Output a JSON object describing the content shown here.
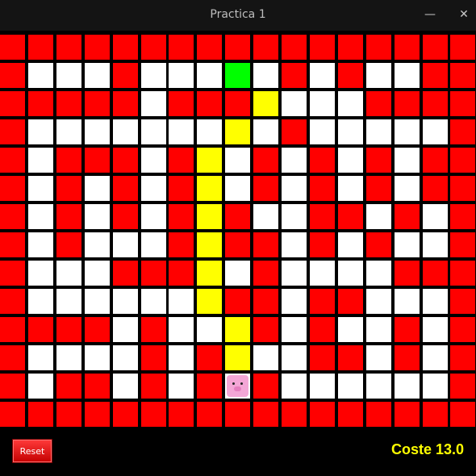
{
  "window": {
    "title": "Practica 1",
    "minimize_glyph": "—",
    "close_glyph": "✕"
  },
  "legend": {
    "W": "wall",
    ".": "free",
    "P": "path",
    "G": "goal",
    "S": "start"
  },
  "colors": {
    "wall": "#ff0000",
    "free": "#ffffff",
    "path": "#ffff00",
    "goal": "#00ff00",
    "start": "#ffffff"
  },
  "grid": {
    "rows": [
      "WWWWWWWWWWWWWWWWW",
      "W...W...G.W.W..W",
      "WWWWW.WWWP...WWW",
      "W.......P.W.....W",
      "W.WWW.WP.W.W.W.W",
      "W.W.W.WP.W.W.W.W",
      "W.W.W.WPW..WW.W.W",
      "W.W...WPWW.W.W..W",
      "W...WWWP.W....WW",
      "W......PWW.WW...W",
      "WWWW.W..PW.W..W.W",
      "W....W.WP..WW.W.W",
      "W.WW.W.WSW......W",
      "WWWWWWWWWWWWWWWWW"
    ]
  },
  "player": {
    "icon": "pig-icon"
  },
  "controls": {
    "reset_label": "Reset"
  },
  "status": {
    "cost_label": "Coste 13.0"
  }
}
